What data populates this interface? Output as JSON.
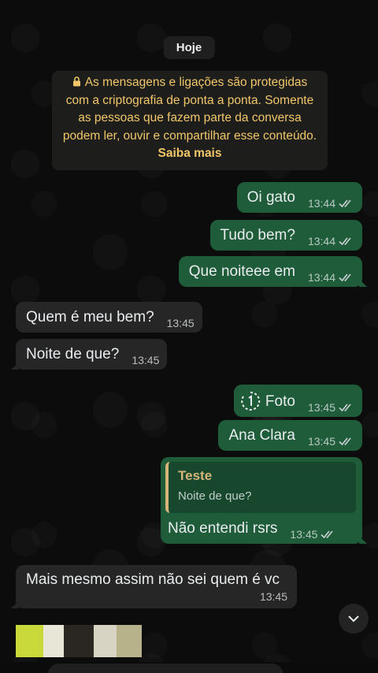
{
  "date_label": "Hoje",
  "encryption_notice": {
    "text": "As mensagens e ligações são protegidas com a criptografia de ponta a ponta. Somente as pessoas que fazem parte da conversa podem ler, ouvir e compartilhar esse conteúdo.",
    "link": "Saiba mais"
  },
  "messages": [
    {
      "dir": "out",
      "text": "Oi gato",
      "time": "13:44"
    },
    {
      "dir": "out",
      "text": "Tudo bem?",
      "time": "13:44"
    },
    {
      "dir": "out",
      "text": "Que noiteee em",
      "time": "13:44"
    },
    {
      "dir": "in",
      "text": "Quem é meu bem?",
      "time": "13:45"
    },
    {
      "dir": "in",
      "text": "Noite de que?",
      "time": "13:45"
    },
    {
      "dir": "out",
      "text": "Foto",
      "time": "13:45",
      "view_once": true
    },
    {
      "dir": "out",
      "text": "Ana Clara",
      "time": "13:45"
    },
    {
      "dir": "out",
      "text": "Não entendi rsrs",
      "time": "13:45",
      "reply": {
        "name": "Teste",
        "text": "Noite de que?"
      }
    },
    {
      "dir": "in",
      "text": "Mais mesmo assim não sei quem é vc",
      "time": "13:45"
    }
  ],
  "colors": {
    "outgoing_bubble": "#1f5c3a",
    "incoming_bubble": "#262626",
    "notice_text": "#f1c76a",
    "reply_accent": "#d6b47a"
  },
  "icons": [
    "lock-icon",
    "double-check-icon",
    "view-once-icon",
    "chevron-down-icon"
  ]
}
